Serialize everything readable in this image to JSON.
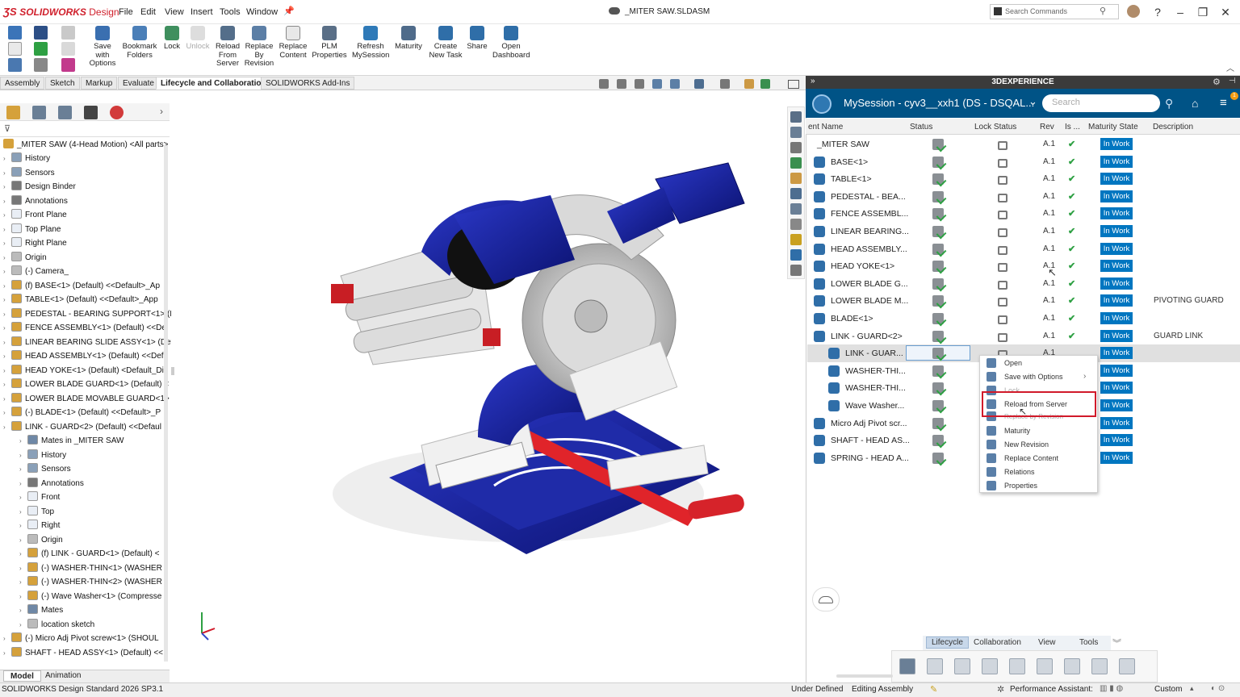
{
  "app": {
    "brand": "SOLIDWORKS",
    "brand_suffix": "Design",
    "document_title": "_MITER SAW.SLDASM"
  },
  "menu": [
    "File",
    "Edit",
    "View",
    "Insert",
    "Tools",
    "Window"
  ],
  "search_commands": {
    "placeholder": "Search Commands"
  },
  "ribbon": [
    {
      "label": "Save\nwith\nOptions",
      "name": "save-with-options"
    },
    {
      "label": "Bookmark\nFolders",
      "name": "bookmark-folders"
    },
    {
      "label": "Lock",
      "name": "lock"
    },
    {
      "label": "Unlock",
      "name": "unlock"
    },
    {
      "label": "Reload\nFrom\nServer",
      "name": "reload-from-server"
    },
    {
      "label": "Replace\nBy\nRevision",
      "name": "replace-by-revision"
    },
    {
      "label": "Replace\nContent",
      "name": "replace-content"
    },
    {
      "label": "PLM\nProperties",
      "name": "plm-properties"
    },
    {
      "label": "Refresh\nMySession",
      "name": "refresh-mysession"
    },
    {
      "label": "Maturity",
      "name": "maturity"
    },
    {
      "label": "Create\nNew Task",
      "name": "create-new-task"
    },
    {
      "label": "Share",
      "name": "share"
    },
    {
      "label": "Open\nDashboard",
      "name": "open-dashboard"
    }
  ],
  "tabs": [
    "Assembly",
    "Sketch",
    "Markup",
    "Evaluate",
    "Lifecycle and Collaboration",
    "SOLIDWORKS Add-Ins"
  ],
  "active_tab": "Lifecycle and Collaboration",
  "tree": {
    "root": "_MITER SAW (4-Head Motion) <All parts>",
    "items": [
      "History",
      "Sensors",
      "Design Binder",
      "Annotations",
      "Front Plane",
      "Top Plane",
      "Right Plane",
      "Origin",
      "(-) Camera_",
      "(f) BASE<1> (Default) <<Default>_Ap",
      "TABLE<1> (Default) <<Default>_App",
      "PEDESTAL - BEARING SUPPORT<1> (I",
      "FENCE ASSEMBLY<1> (Default) <<De",
      "LINEAR BEARING SLIDE ASSY<1> (Def",
      "HEAD ASSEMBLY<1> (Default) <<Def",
      "HEAD YOKE<1> (Default) <Default_Di",
      "LOWER BLADE GUARD<1> (Default) <",
      "LOWER BLADE MOVABLE GUARD<1>",
      "(-) BLADE<1> (Default) <<Default>_P",
      "LINK - GUARD<2> (Default) <<Defaul",
      "Mates in _MITER SAW",
      "History",
      "Sensors",
      "Annotations",
      "Front",
      "Top",
      "Right",
      "Origin",
      "(f) LINK - GUARD<1> (Default) <",
      "(-) WASHER-THIN<1> (WASHER",
      "(-) WASHER-THIN<2> (WASHER",
      "(-) Wave Washer<1> (Compresse",
      "Mates",
      "location sketch",
      "(-) Micro Adj Pivot screw<1> (SHOUL",
      "SHAFT - HEAD ASSY<1> (Default) <<"
    ]
  },
  "bottom_tabs": [
    "Model",
    "Animation"
  ],
  "status": {
    "left": "SOLIDWORKS Design Standard 2026 SP3.1",
    "under_defined": "Under Defined",
    "editing": "Editing Assembly",
    "perf": "Performance Assistant:",
    "custom": "Custom"
  },
  "tdx": {
    "header": "3DEXPERIENCE",
    "session": "MySession - cyv3__xxh1 (DS - DSQAL...",
    "search_placeholder": "Search",
    "columns": [
      "ent Name",
      "Status",
      "Lock Status",
      "Rev",
      "Is ...",
      "Maturity State",
      "Description"
    ],
    "rows": [
      {
        "name": "_MITER SAW",
        "rev": "A.1",
        "maturity": "In Work",
        "desc": "",
        "indent": 0
      },
      {
        "name": "BASE<1>",
        "rev": "A.1",
        "maturity": "In Work",
        "desc": "",
        "indent": 0
      },
      {
        "name": "TABLE<1>",
        "rev": "A.1",
        "maturity": "In Work",
        "desc": "",
        "indent": 0
      },
      {
        "name": "PEDESTAL - BEA...",
        "rev": "A.1",
        "maturity": "In Work",
        "desc": "",
        "indent": 0
      },
      {
        "name": "FENCE ASSEMBL...",
        "rev": "A.1",
        "maturity": "In Work",
        "desc": "",
        "indent": 0
      },
      {
        "name": "LINEAR BEARING...",
        "rev": "A.1",
        "maturity": "In Work",
        "desc": "",
        "indent": 0
      },
      {
        "name": "HEAD ASSEMBLY...",
        "rev": "A.1",
        "maturity": "In Work",
        "desc": "",
        "indent": 0
      },
      {
        "name": "HEAD YOKE<1>",
        "rev": "A.1",
        "maturity": "In Work",
        "desc": "",
        "indent": 0
      },
      {
        "name": "LOWER BLADE G...",
        "rev": "A.1",
        "maturity": "In Work",
        "desc": "",
        "indent": 0
      },
      {
        "name": "LOWER BLADE M...",
        "rev": "A.1",
        "maturity": "In Work",
        "desc": "PIVOTING GUARD",
        "indent": 0
      },
      {
        "name": "BLADE<1>",
        "rev": "A.1",
        "maturity": "In Work",
        "desc": "",
        "indent": 0
      },
      {
        "name": "LINK - GUARD<2>",
        "rev": "A.1",
        "maturity": "In Work",
        "desc": "GUARD LINK",
        "indent": 0
      },
      {
        "name": "LINK - GUAR...",
        "rev": "A.1",
        "maturity": "In Work",
        "desc": "",
        "indent": 1
      },
      {
        "name": "WASHER-THI...",
        "rev": "",
        "maturity": "In Work",
        "desc": "",
        "indent": 1
      },
      {
        "name": "WASHER-THI...",
        "rev": "",
        "maturity": "In Work",
        "desc": "",
        "indent": 1
      },
      {
        "name": "Wave Washer...",
        "rev": "",
        "maturity": "In Work",
        "desc": "",
        "indent": 1
      },
      {
        "name": "Micro Adj Pivot scr...",
        "rev": "",
        "maturity": "In Work",
        "desc": "",
        "indent": 0
      },
      {
        "name": "SHAFT - HEAD AS...",
        "rev": "",
        "maturity": "In Work",
        "desc": "",
        "indent": 0
      },
      {
        "name": "SPRING - HEAD A...",
        "rev": "",
        "maturity": "In Work",
        "desc": "",
        "indent": 0
      }
    ],
    "context_menu": [
      "Open",
      "Save with Options",
      "Lock",
      "Reload from Server",
      "Replace by Revision",
      "Maturity",
      "New Revision",
      "Replace Content",
      "Relations",
      "Properties"
    ],
    "highlighted_menu_item": "Reload from Server",
    "bottom_tabs": [
      "Lifecycle",
      "Collaboration",
      "View",
      "Tools"
    ]
  },
  "colors": {
    "accent": "#005386",
    "maturity": "#0076c0",
    "highlight": "#d11a2a",
    "brand": "#d0202c"
  }
}
